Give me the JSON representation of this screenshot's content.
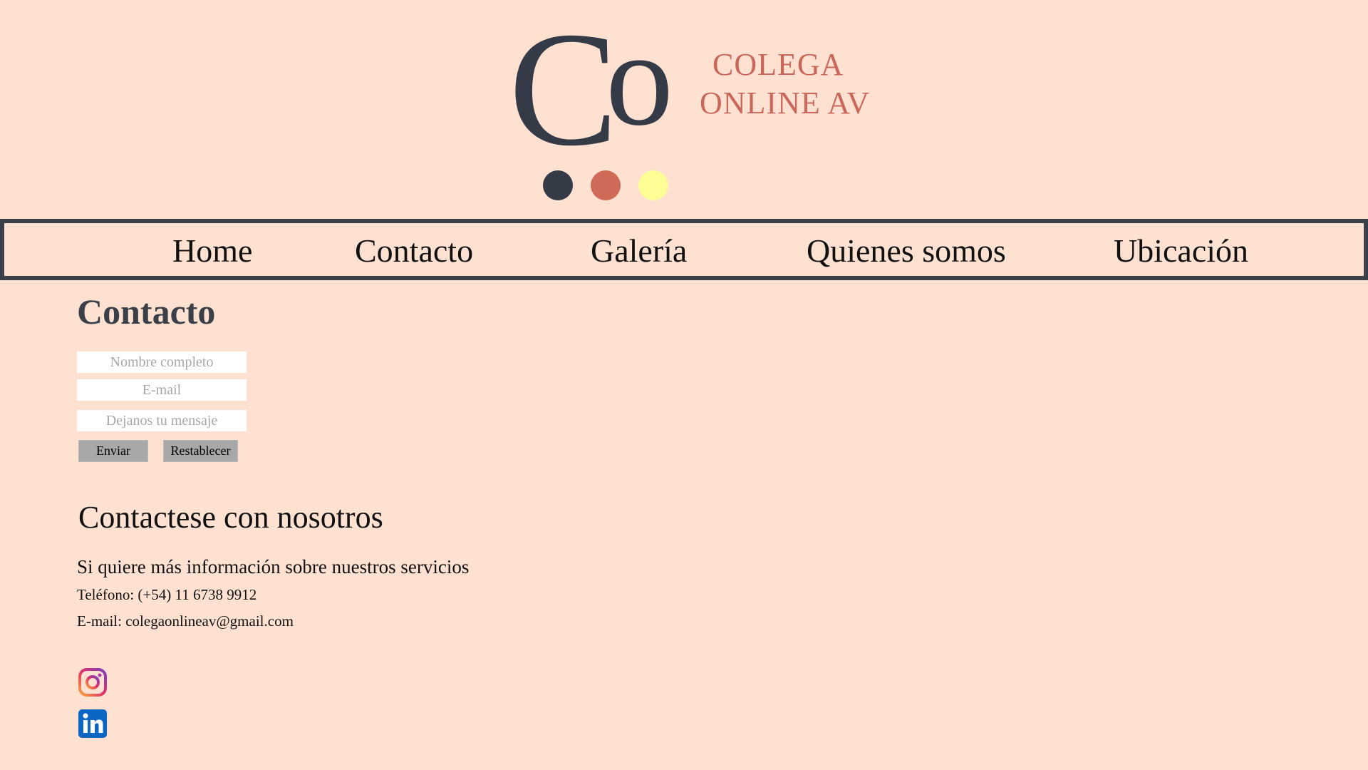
{
  "brand": {
    "monogram": "Co",
    "name_line1": "COLEGA",
    "name_line2": "ONLINE AV",
    "colors": {
      "dark": "#343a46",
      "coral": "#d06a58",
      "yellow": "#fdfd96",
      "background": "#ffe1d2"
    }
  },
  "nav": {
    "items": [
      {
        "label": "Home"
      },
      {
        "label": "Contacto"
      },
      {
        "label": "Galería"
      },
      {
        "label": "Quienes somos"
      },
      {
        "label": "Ubicación"
      }
    ]
  },
  "contact_form": {
    "title": "Contacto",
    "name_placeholder": "Nombre completo",
    "email_placeholder": "E-mail",
    "message_placeholder": "Dejanos tu mensaje",
    "submit_label": "Enviar",
    "reset_label": "Restablecer"
  },
  "info": {
    "title": "Contactese con nosotros",
    "lead": "Si quiere más información sobre nuestros servicios",
    "phone": "Teléfono: (+54) 11 6738 9912",
    "email": "E-mail: colegaonlineav@gmail.com"
  },
  "social": {
    "icons": [
      "instagram-icon",
      "linkedin-icon"
    ]
  }
}
